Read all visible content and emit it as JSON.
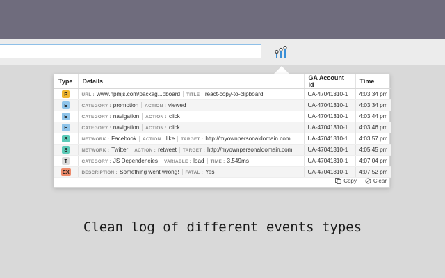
{
  "browser": {
    "extension_icon": "signal-bars-icon"
  },
  "popup": {
    "headers": {
      "type": "Type",
      "details": "Details",
      "account": "GA Account Id",
      "time": "Time"
    },
    "rows": [
      {
        "type": "P",
        "color": "#f0b62e",
        "details": [
          {
            "k": "URL :",
            "v": "www.npmjs.com/packag...pboard"
          },
          {
            "k": "TITLE :",
            "v": "react-copy-to-clipboard"
          }
        ],
        "account": "UA-47041310-1",
        "time": "4:03:34 pm"
      },
      {
        "type": "E",
        "color": "#8fc4ea",
        "details": [
          {
            "k": "CATEGORY :",
            "v": "promotion"
          },
          {
            "k": "ACTION :",
            "v": "viewed"
          }
        ],
        "account": "UA-47041310-1",
        "time": "4:03:34 pm"
      },
      {
        "type": "E",
        "color": "#8fc4ea",
        "details": [
          {
            "k": "CATEGORY :",
            "v": "navigation"
          },
          {
            "k": "ACTION :",
            "v": "click"
          }
        ],
        "account": "UA-47041310-1",
        "time": "4:03:44 pm"
      },
      {
        "type": "E",
        "color": "#8fc4ea",
        "details": [
          {
            "k": "CATEGORY :",
            "v": "navigation"
          },
          {
            "k": "ACTION :",
            "v": "click"
          }
        ],
        "account": "UA-47041310-1",
        "time": "4:03:46 pm"
      },
      {
        "type": "S",
        "color": "#5ccbb8",
        "details": [
          {
            "k": "NETWORK :",
            "v": "Facebook"
          },
          {
            "k": "ACTION :",
            "v": "like"
          },
          {
            "k": "TARGET :",
            "v": "http://myownpersonaldomain.com"
          }
        ],
        "account": "UA-47041310-1",
        "time": "4:03:57 pm"
      },
      {
        "type": "S",
        "color": "#5ccbb8",
        "details": [
          {
            "k": "NETWORK :",
            "v": "Twitter"
          },
          {
            "k": "ACTION :",
            "v": "retweet"
          },
          {
            "k": "TARGET :",
            "v": "http://myownpersonaldomain.com"
          }
        ],
        "account": "UA-47041310-1",
        "time": "4:05:45 pm"
      },
      {
        "type": "T",
        "color": "#dcdcdc",
        "details": [
          {
            "k": "CATEGORY :",
            "v": "JS Dependencies"
          },
          {
            "k": "VARIABLE :",
            "v": "load"
          },
          {
            "k": "TIME :",
            "v": "3,549ms"
          }
        ],
        "account": "UA-47041310-1",
        "time": "4:07:04 pm"
      },
      {
        "type": "EX",
        "color": "#ee8a6a",
        "details": [
          {
            "k": "DESCRIPTION :",
            "v": "Something went wrong!"
          },
          {
            "k": "FATAL :",
            "v": "Yes"
          }
        ],
        "account": "UA-47041310-1",
        "time": "4:07:52 pm"
      }
    ],
    "footer": {
      "copy_label": "Copy",
      "copy_icon": "copy-icon",
      "clear_label": "Clear",
      "clear_icon": "clear-icon"
    }
  },
  "caption": "Clean log of different events types"
}
